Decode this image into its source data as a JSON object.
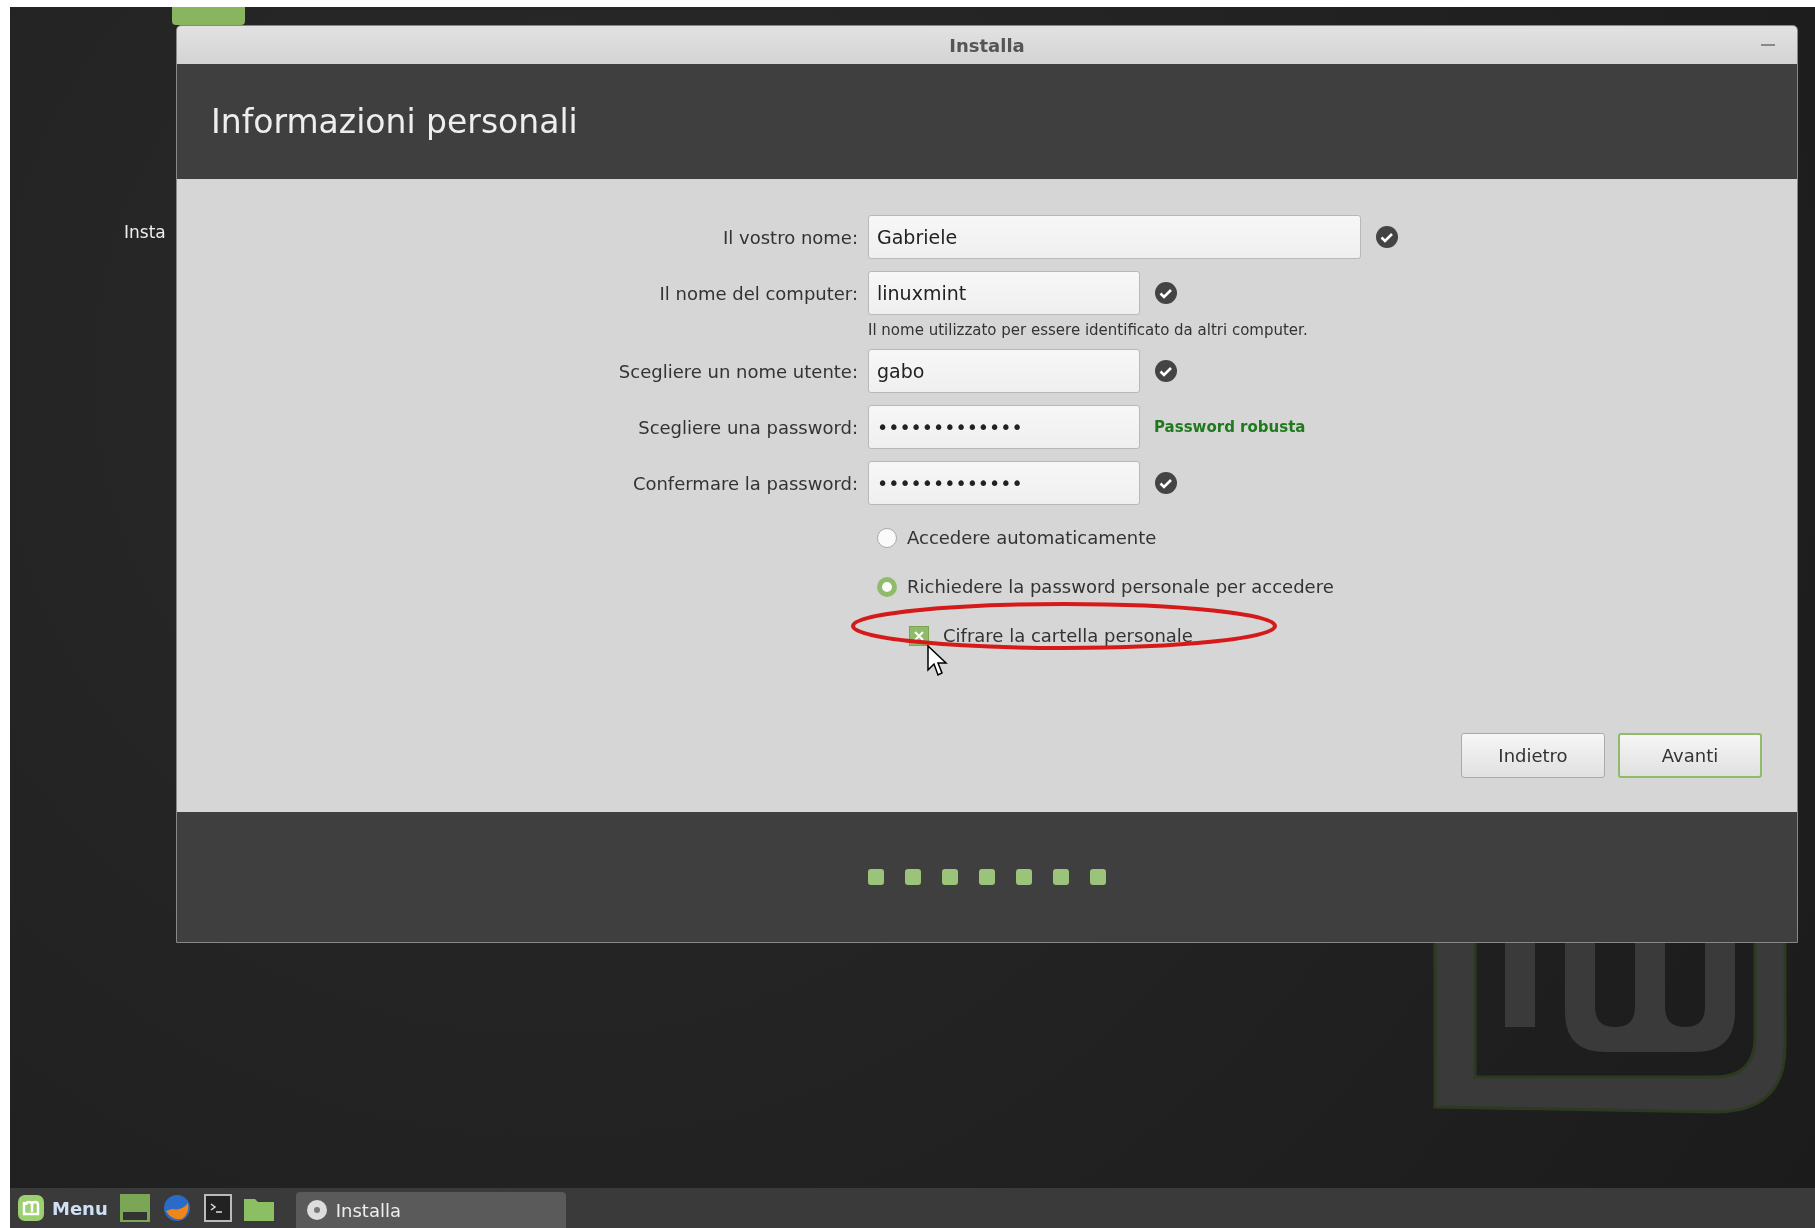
{
  "desktop": {
    "icon_label": "Insta"
  },
  "window": {
    "title": "Installa"
  },
  "header": {
    "title": "Informazioni personali"
  },
  "fields": [
    {
      "kind": "check",
      "label": "Il vostro nome:",
      "value": "Gabriele",
      "wide": true
    },
    {
      "kind": "check",
      "label": "Il nome del computer:",
      "value": "linuxmint",
      "wide": false,
      "hint": "Il nome utilizzato per essere identificato da altri computer."
    },
    {
      "kind": "check",
      "label": "Scegliere un nome utente:",
      "value": "gabo",
      "wide": false
    },
    {
      "kind": "strength",
      "label": "Scegliere una password:",
      "value": "•••••••••••••",
      "wide": false,
      "status_text": "Password robusta"
    },
    {
      "kind": "check",
      "label": "Confermare la password:",
      "value": "•••••••••••••",
      "wide": false
    }
  ],
  "login_options": [
    {
      "label": "Accedere automaticamente",
      "selected": false
    },
    {
      "label": "Richiedere la password personale per accedere",
      "selected": true
    }
  ],
  "encrypt": {
    "label": "Cifrare la cartella personale",
    "checked": true
  },
  "buttons": [
    {
      "label": "Indietro",
      "default": false
    },
    {
      "label": "Avanti",
      "default": true
    }
  ],
  "taskbar": {
    "menu_label": "Menu",
    "window_button": "Installa"
  }
}
